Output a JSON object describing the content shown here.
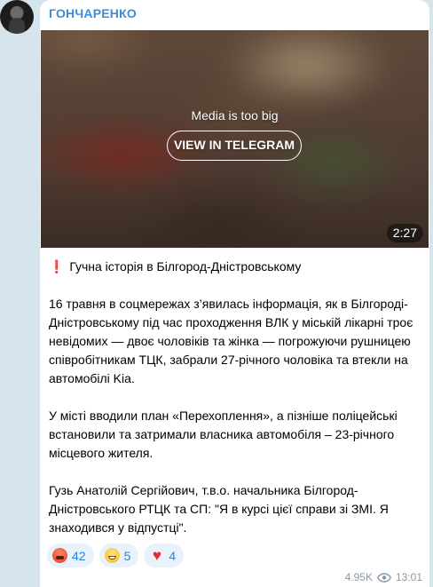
{
  "channel": {
    "name": "ГОНЧАРЕНКО"
  },
  "media": {
    "notice": "Media is too big",
    "button_label": "VIEW IN TELEGRAM",
    "duration": "2:27"
  },
  "post": {
    "headline_icon": "❗",
    "headline": "Гучна історія в Білгород-Дністровському",
    "paragraphs": [
      "16 травня в соцмережах з’явилась інформація, як в Білгороді-Дністровському під час проходження ВЛК у міській лікарні троє невідомих — двоє чоловіків та жінка — погрожуючи рушницею співробітникам ТЦК, забрали 27-річного чоловіка та втекли на автомобілі Kia.",
      "У місті вводили план «Перехоплення», а пізніше поліцейські встановили та затримали власника автомобіля – 23-річного місцевого жителя.",
      "Гузь Анатолій Сергійович, т.в.о. начальника Білгород-Дністровського РТЦК та СП: \"Я в курсі цієї справи зі ЗМІ. Я знаходився у відпустці\"."
    ]
  },
  "reactions": [
    {
      "icon": "angry-face-icon",
      "count": "42"
    },
    {
      "icon": "grinning-face-icon",
      "count": "5"
    },
    {
      "icon": "heart-icon",
      "count": "4"
    }
  ],
  "meta": {
    "views": "4.95K",
    "time": "13:01"
  },
  "colors": {
    "channel_name": "#3a8dd8",
    "reaction_count": "#2f82d6",
    "background": "#d6e4ee"
  }
}
